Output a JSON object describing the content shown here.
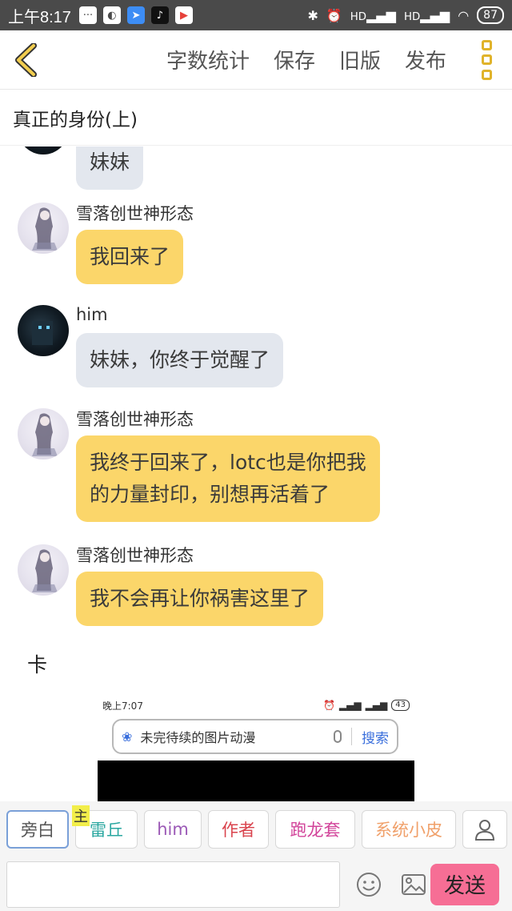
{
  "status_bar": {
    "time": "上午8:17",
    "battery": "87",
    "signal_label": "HD"
  },
  "toolbar": {
    "word_count": "字数统计",
    "save": "保存",
    "old_version": "旧版",
    "publish": "发布"
  },
  "doc": {
    "title": "真正的身份(上)"
  },
  "chat": {
    "messages": [
      {
        "speaker": "",
        "text": "妹妹",
        "style": "grey"
      },
      {
        "speaker": "雪落创世神形态",
        "text": "我回来了",
        "style": "yellow"
      },
      {
        "speaker": "him",
        "text": "妹妹，你终于觉醒了",
        "style": "grey"
      },
      {
        "speaker": "雪落创世神形态",
        "text_line1": "我终于回来了，lotc也是你把我",
        "text_line2": "的力量封印，别想再活着了",
        "style": "yellow"
      },
      {
        "speaker": "雪落创世神形态",
        "text": "我不会再让你祸害这里了",
        "style": "yellow"
      }
    ],
    "narration": "卡",
    "embedded": {
      "time": "晚上7:07",
      "battery": "43",
      "search_text": "未完待续的图片动漫",
      "search_button": "搜索"
    }
  },
  "roles": {
    "narrator": "旁白",
    "host_tag": "主",
    "items": [
      {
        "label": "雷丘",
        "color": "#2aa7a0"
      },
      {
        "label": "him",
        "color": "#9b59b6"
      },
      {
        "label": "作者",
        "color": "#d9434d"
      },
      {
        "label": "跑龙套",
        "color": "#d2449a"
      },
      {
        "label": "系统小皮",
        "color": "#f0a06a"
      }
    ]
  },
  "input": {
    "placeholder": "",
    "send": "发送"
  }
}
